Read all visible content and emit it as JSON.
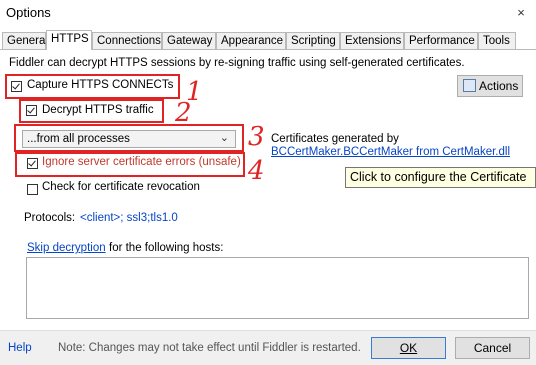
{
  "window": {
    "title": "Options",
    "close_icon": "×"
  },
  "tabs": [
    {
      "label": "General"
    },
    {
      "label": "HTTPS"
    },
    {
      "label": "Connections"
    },
    {
      "label": "Gateway"
    },
    {
      "label": "Appearance"
    },
    {
      "label": "Scripting"
    },
    {
      "label": "Extensions"
    },
    {
      "label": "Performance"
    },
    {
      "label": "Tools"
    }
  ],
  "active_tab": "HTTPS",
  "https": {
    "description": "Fiddler can decrypt HTTPS sessions by re-signing traffic using self-generated certificates.",
    "capture_label": "Capture HTTPS CONNECTs",
    "capture_checked": true,
    "decrypt_label": "Decrypt HTTPS traffic",
    "decrypt_checked": true,
    "process_filter": "...from all processes",
    "ignore_errors_label": "Ignore server certificate errors (unsafe)",
    "ignore_errors_checked": true,
    "revocation_label": "Check for certificate revocation",
    "revocation_checked": false,
    "actions_label": "Actions",
    "cert_generated_label": "Certificates generated by",
    "cert_generator_link": "BCCertMaker.BCCertMaker from CertMaker.dll",
    "tooltip": "Click to configure the Certificate",
    "protocols_label": "Protocols:",
    "protocols_value": "<client>; ssl3;tls1.0",
    "skip_link": "Skip decryption",
    "skip_suffix": "for the following hosts:",
    "skip_hosts_value": ""
  },
  "annotations": [
    "1",
    "2",
    "3",
    "4"
  ],
  "footer": {
    "help": "Help",
    "note": "Note: Changes may not take effect until Fiddler is restarted.",
    "ok": "OK",
    "cancel": "Cancel"
  },
  "colors": {
    "annotation": "#e02424",
    "link": "#0645c5",
    "tooltip_bg": "#ffffe1"
  }
}
